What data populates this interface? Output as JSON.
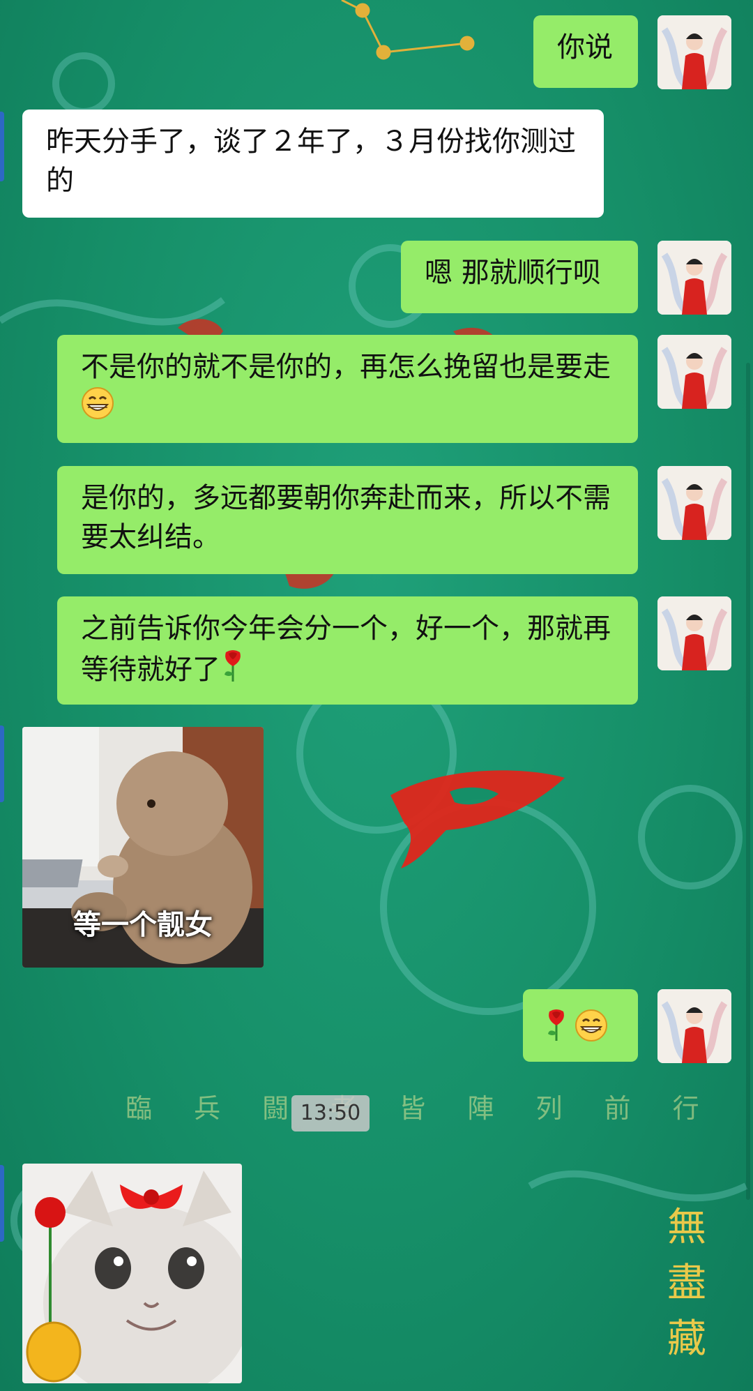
{
  "chat": {
    "messages": [
      {
        "side": "right",
        "text": "你说"
      },
      {
        "side": "left",
        "text": "昨天分手了，谈了２年了，３月份找你测过的"
      },
      {
        "side": "right",
        "text": "嗯 那就顺行呗"
      },
      {
        "side": "right",
        "text": "不是你的就不是你的，再怎么挽留也是要走",
        "emoji": "grin-emoji"
      },
      {
        "side": "right",
        "text": "是你的，多远都要朝你奔赴而来，所以不需要太纠结。"
      },
      {
        "side": "right",
        "text": "之前告诉你今年会分一个，好一个，那就再等待就好了",
        "emoji": "rose-emoji"
      },
      {
        "side": "left",
        "type": "sticker",
        "caption": "等一个靓女"
      },
      {
        "side": "right",
        "emojis": [
          "rose-emoji",
          "grin-emoji"
        ]
      },
      {
        "side": "left",
        "type": "sticker",
        "caption": ""
      }
    ],
    "timestamp": "13:50"
  },
  "background": {
    "watermark": "臨 兵 闘 者 皆 陣 列 前 行",
    "seal": "無盡藏",
    "colors": {
      "base": "#168f68",
      "accent_red": "#e0261c",
      "bubble_green": "#95ec69"
    }
  }
}
